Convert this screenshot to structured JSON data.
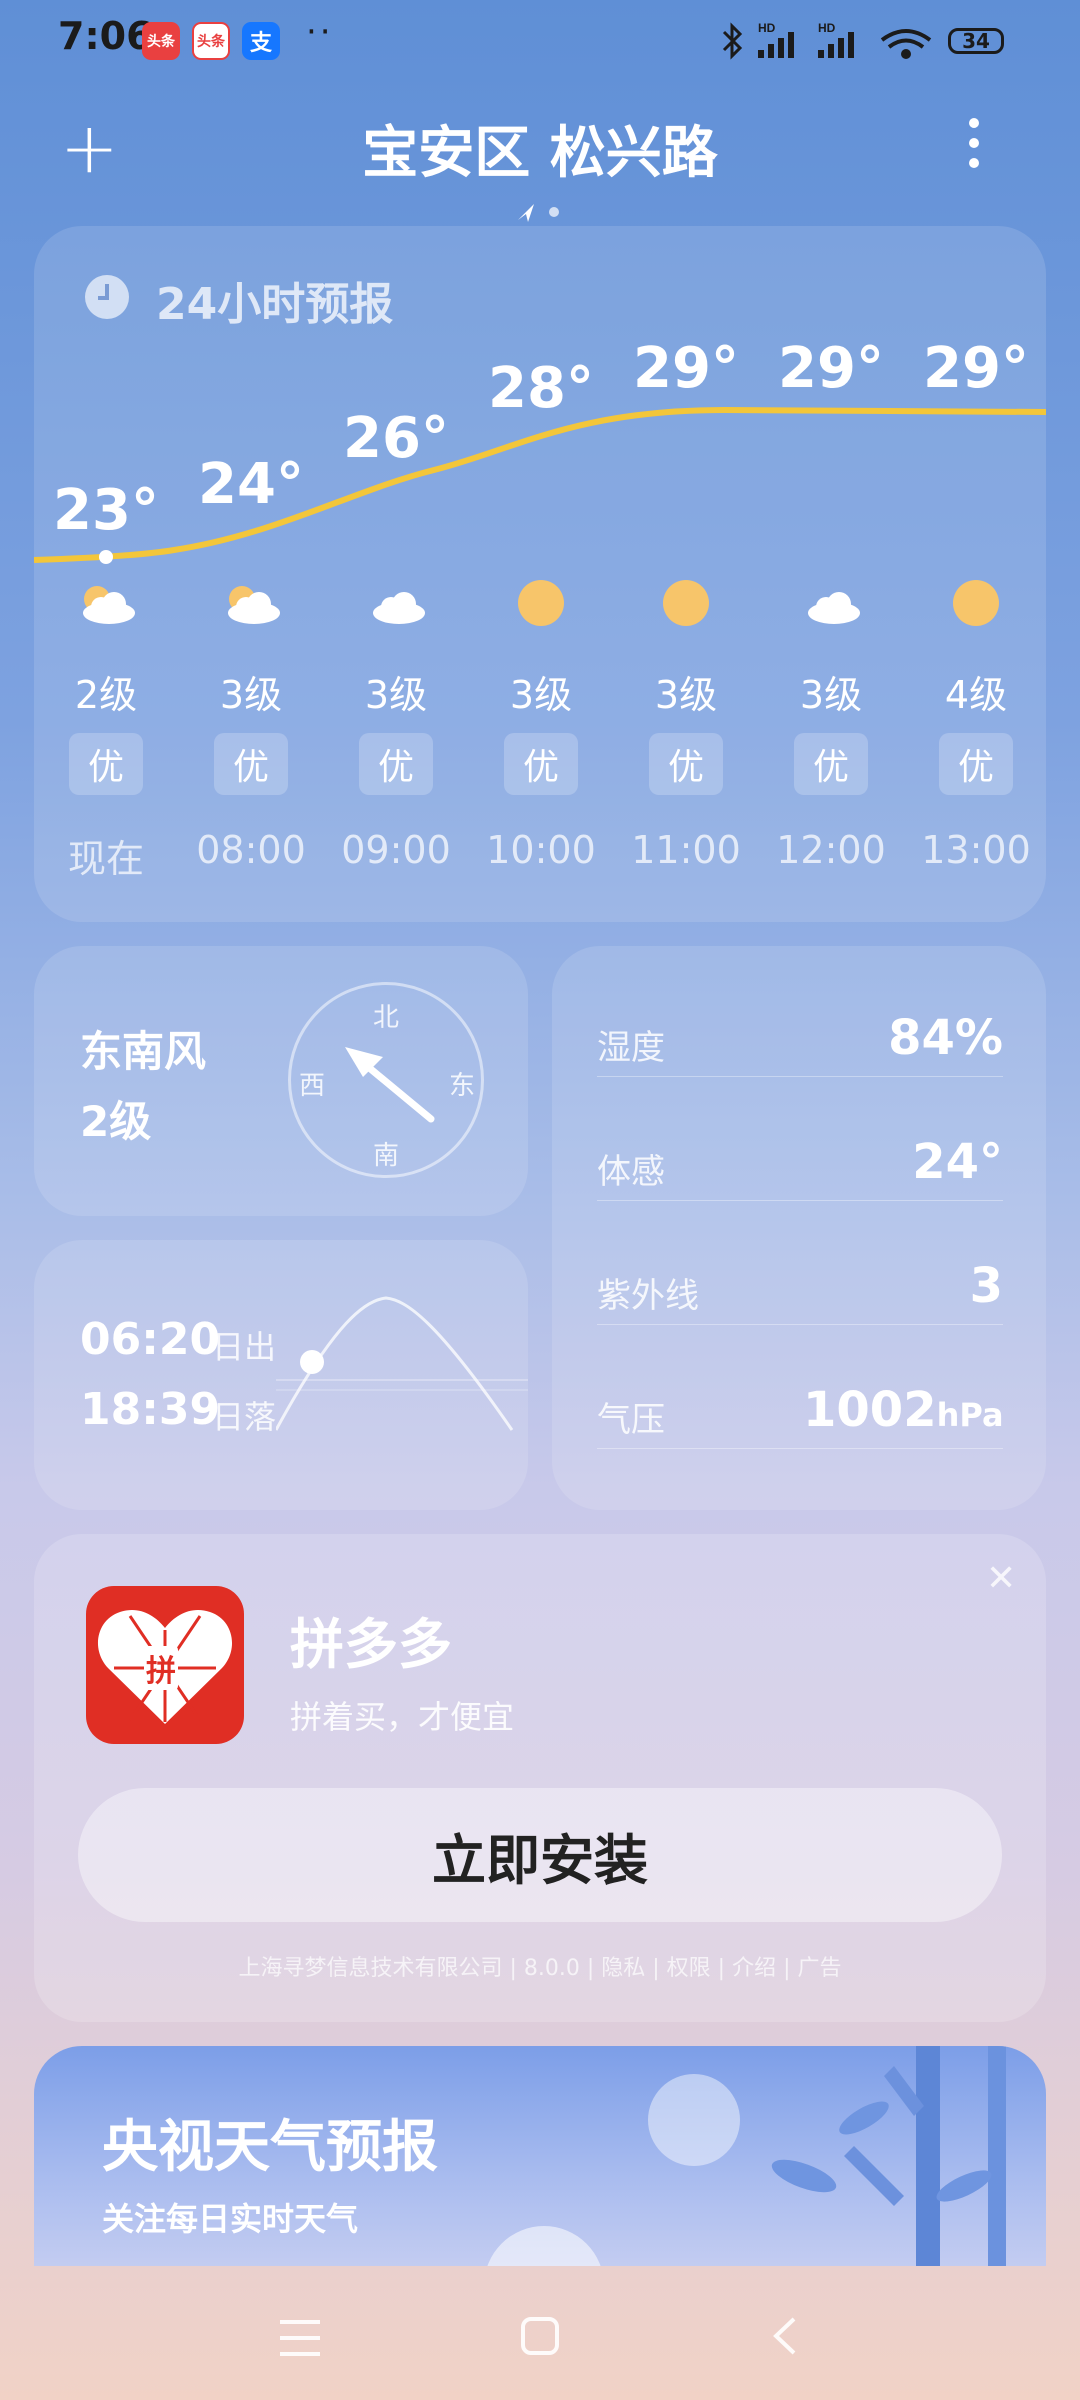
{
  "status_bar": {
    "time": "7:06",
    "apps": [
      {
        "name": "toutiao-icon",
        "label": "头条",
        "color": "#e94040"
      },
      {
        "name": "toutiao-lite-icon",
        "label": "头条",
        "color": "#e94040"
      },
      {
        "name": "alipay-icon",
        "label": "支",
        "color": "#1677ff"
      }
    ],
    "dots": "··",
    "battery": "34"
  },
  "header": {
    "add_label": "+",
    "city": "宝安区 松兴路"
  },
  "forecast": {
    "title": "24小时预报",
    "hours": [
      {
        "temp": "23°",
        "wind": "2级",
        "aqi": "优",
        "time": "现在",
        "icon": "partly-cloudy-icon"
      },
      {
        "temp": "24°",
        "wind": "3级",
        "aqi": "优",
        "time": "08:00",
        "icon": "partly-cloudy-icon"
      },
      {
        "temp": "26°",
        "wind": "3级",
        "aqi": "优",
        "time": "09:00",
        "icon": "cloud-icon"
      },
      {
        "temp": "28°",
        "wind": "3级",
        "aqi": "优",
        "time": "10:00",
        "icon": "sun-icon"
      },
      {
        "temp": "29°",
        "wind": "3级",
        "aqi": "优",
        "time": "11:00",
        "icon": "sun-icon"
      },
      {
        "temp": "29°",
        "wind": "3级",
        "aqi": "优",
        "time": "12:00",
        "icon": "cloud-icon"
      },
      {
        "temp": "29°",
        "wind": "4级",
        "aqi": "优",
        "time": "13:00",
        "icon": "sun-icon"
      }
    ]
  },
  "wind": {
    "direction": "东南风",
    "level": "2级",
    "compass": {
      "n": "北",
      "s": "南",
      "e": "东",
      "w": "西"
    }
  },
  "sun": {
    "sunrise_time": "06:20",
    "sunrise_label": "日出",
    "sunset_time": "18:39",
    "sunset_label": "日落"
  },
  "details": {
    "humidity_label": "湿度",
    "humidity": "84%",
    "feels_label": "体感",
    "feels": "24°",
    "uv_label": "紫外线",
    "uv": "3",
    "pressure_label": "气压",
    "pressure": "1002",
    "pressure_unit": "hPa"
  },
  "ad": {
    "app_name": "拼多多",
    "slogan": "拼着买，才便宜",
    "logo_char": "拼",
    "install_label": "立即安装",
    "footer": "上海寻梦信息技术有限公司 | 8.0.0 | 隐私 | 权限 | 介绍 | 广告",
    "close": "✕"
  },
  "cctv": {
    "title": "央视天气预报",
    "subtitle": "关注每日实时天气"
  },
  "colors": {
    "curve": "#f3b928",
    "ad_red": "#e02e24"
  }
}
